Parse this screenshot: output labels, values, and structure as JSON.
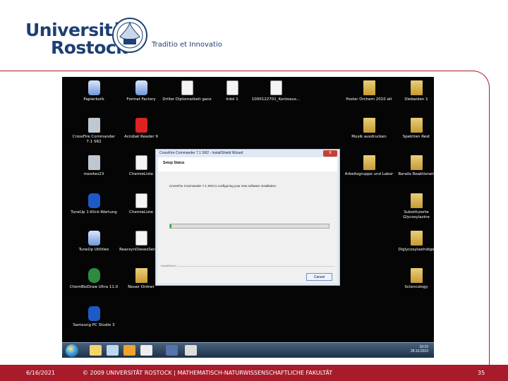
{
  "slide": {
    "logo_line1": "Universität",
    "logo_line2": "Rostock",
    "motto": "Traditio et Innovatio",
    "footer_date": "6/16/2021",
    "footer_text": "© 2009 UNIVERSITÄT ROSTOCK | MATHEMATISCH-NATURWISSENSCHAFTLICHE FAKULTÄT",
    "page_number": "35"
  },
  "desktop": {
    "icons": [
      {
        "label": "Papierkorb",
        "kind": "app"
      },
      {
        "label": "Format Factory",
        "kind": "app"
      },
      {
        "label": "Driller Diplomarbeit ganz",
        "kind": "doc"
      },
      {
        "label": "Irdol 1",
        "kind": "doc"
      },
      {
        "label": "1000122701_Kontoaus...",
        "kind": "doc"
      },
      {
        "label": "Poster Orchem 2010 alt",
        "kind": "folder"
      },
      {
        "label": "Diebaiden 1",
        "kind": "folder"
      },
      {
        "label": "CrossFire Commander 7.1 SR2",
        "kind": "gray"
      },
      {
        "label": "Acrobat Reader 9",
        "kind": "red"
      },
      {
        "label": "Musik ausdrucken",
        "kind": "folder"
      },
      {
        "label": "Spektren Rest",
        "kind": "folder"
      },
      {
        "label": "mesites23",
        "kind": "gray"
      },
      {
        "label": "ChemieListe",
        "kind": "doc"
      },
      {
        "label": "Arbeitsgruppe und Labor",
        "kind": "folder"
      },
      {
        "label": "Baralis Reaktionen",
        "kind": "folder"
      },
      {
        "label": "TuneUp 1-Klick-Wartung",
        "kind": "blue"
      },
      {
        "label": "ChemieListe",
        "kind": "doc"
      },
      {
        "label": "Substituierte Glycosylazine",
        "kind": "folder"
      },
      {
        "label": "TuneUp Utilities",
        "kind": "app"
      },
      {
        "label": "ReacsynDiesesSemina",
        "kind": "doc"
      },
      {
        "label": "Diglycosylazindige",
        "kind": "folder"
      },
      {
        "label": "ChemBioDraw Ultra 11.0",
        "kind": "green"
      },
      {
        "label": "Neuer Ordner",
        "kind": "folder"
      },
      {
        "label": "Sciencology",
        "kind": "folder"
      },
      {
        "label": "Samsung PC Studio 3",
        "kind": "blue"
      }
    ],
    "clock_time": "10:15",
    "clock_date": "28.10.2010"
  },
  "dialog": {
    "title": "CrossFire Commander 7.1 SR2 - InstallShield Wizard",
    "heading": "Setup Status",
    "message": "CrossFire Commander 7.1 SR2 is configuring your new software installation.",
    "progress": 0.01,
    "provider": "InstallShield",
    "cancel_label": "Cancel",
    "close_label": "x"
  }
}
